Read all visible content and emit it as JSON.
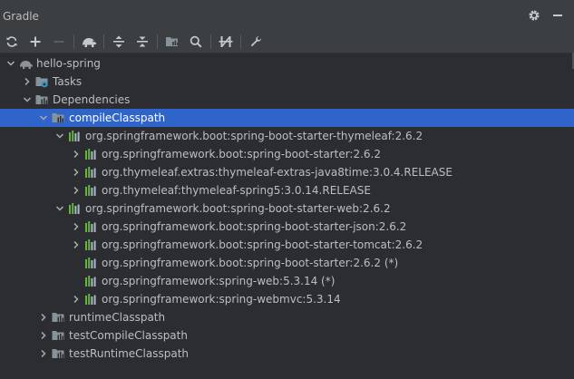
{
  "panel": {
    "title": "Gradle",
    "settings_icon": "gear-icon",
    "minimize_icon": "minimize-icon"
  },
  "toolbar": {
    "buttons": [
      {
        "name": "reload-button",
        "icon": "refresh-icon",
        "enabled": true
      },
      {
        "name": "add-button",
        "icon": "plus-icon",
        "enabled": true
      },
      {
        "name": "remove-button",
        "icon": "minus-icon",
        "enabled": false
      },
      {
        "name": "toggle-offline-button",
        "icon": "elephant-icon",
        "enabled": true
      },
      {
        "name": "expand-all-button",
        "icon": "expand-all-icon",
        "enabled": true
      },
      {
        "name": "collapse-all-button",
        "icon": "collapse-all-icon",
        "enabled": true
      },
      {
        "name": "analyze-dependencies-button",
        "icon": "analyze-icon",
        "enabled": true
      },
      {
        "name": "search-button",
        "icon": "search-icon",
        "enabled": true
      },
      {
        "name": "toggle-skip-tests-button",
        "icon": "skip-tests-icon",
        "enabled": true
      },
      {
        "name": "build-tool-settings-button",
        "icon": "wrench-icon",
        "enabled": true
      }
    ]
  },
  "tree": {
    "nodes": [
      {
        "label": "hello-spring",
        "icon": "gradle-project-icon",
        "depth": 0,
        "arrow": "expanded",
        "selected": false
      },
      {
        "label": "Tasks",
        "icon": "tasks-folder-icon",
        "depth": 1,
        "arrow": "collapsed",
        "selected": false
      },
      {
        "label": "Dependencies",
        "icon": "dependencies-folder-icon",
        "depth": 1,
        "arrow": "expanded",
        "selected": false
      },
      {
        "label": "compileClasspath",
        "icon": "configuration-folder-icon",
        "depth": 2,
        "arrow": "expanded",
        "selected": true
      },
      {
        "label": "org.springframework.boot:spring-boot-starter-thymeleaf:2.6.2",
        "icon": "library-icon",
        "depth": 3,
        "arrow": "expanded",
        "selected": false
      },
      {
        "label": "org.springframework.boot:spring-boot-starter:2.6.2",
        "icon": "library-icon",
        "depth": 4,
        "arrow": "collapsed",
        "selected": false
      },
      {
        "label": "org.thymeleaf.extras:thymeleaf-extras-java8time:3.0.4.RELEASE",
        "icon": "library-icon",
        "depth": 4,
        "arrow": "collapsed",
        "selected": false
      },
      {
        "label": "org.thymeleaf:thymeleaf-spring5:3.0.14.RELEASE",
        "icon": "library-icon",
        "depth": 4,
        "arrow": "collapsed",
        "selected": false
      },
      {
        "label": "org.springframework.boot:spring-boot-starter-web:2.6.2",
        "icon": "library-icon",
        "depth": 3,
        "arrow": "expanded",
        "selected": false
      },
      {
        "label": "org.springframework.boot:spring-boot-starter-json:2.6.2",
        "icon": "library-icon",
        "depth": 4,
        "arrow": "collapsed",
        "selected": false
      },
      {
        "label": "org.springframework.boot:spring-boot-starter-tomcat:2.6.2",
        "icon": "library-icon",
        "depth": 4,
        "arrow": "collapsed",
        "selected": false
      },
      {
        "label": "org.springframework.boot:spring-boot-starter:2.6.2 (*)",
        "icon": "library-icon",
        "depth": 4,
        "arrow": "none",
        "selected": false
      },
      {
        "label": "org.springframework:spring-web:5.3.14 (*)",
        "icon": "library-icon",
        "depth": 4,
        "arrow": "none",
        "selected": false
      },
      {
        "label": "org.springframework:spring-webmvc:5.3.14",
        "icon": "library-icon",
        "depth": 4,
        "arrow": "collapsed",
        "selected": false
      },
      {
        "label": "runtimeClasspath",
        "icon": "configuration-folder-icon",
        "depth": 2,
        "arrow": "collapsed",
        "selected": false
      },
      {
        "label": "testCompileClasspath",
        "icon": "configuration-folder-icon",
        "depth": 2,
        "arrow": "collapsed",
        "selected": false
      },
      {
        "label": "testRuntimeClasspath",
        "icon": "configuration-folder-icon",
        "depth": 2,
        "arrow": "collapsed",
        "selected": false
      }
    ]
  },
  "colors": {
    "background": "#2b2d30",
    "toolbar": "#3c3f41",
    "selection": "#2f65ca",
    "text": "#bbbfc4",
    "library_green": "#62b543",
    "folder": "#87939a"
  }
}
